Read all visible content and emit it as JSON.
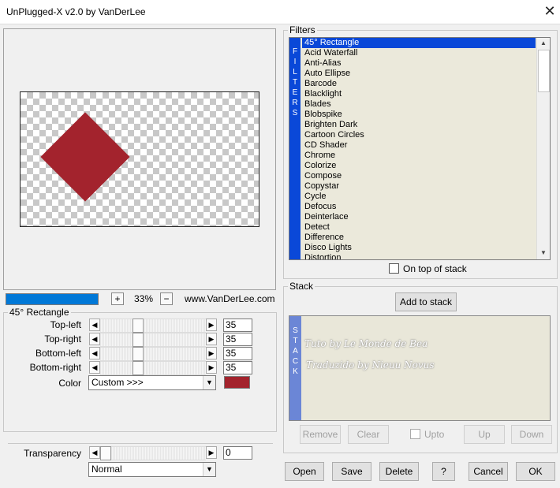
{
  "window": {
    "title": "UnPlugged-X v2.0 by VanDerLee",
    "close_glyph": "✕"
  },
  "preview": {
    "zoom_percent": "33%",
    "zoom_plus": "+",
    "zoom_minus": "−",
    "website": "www.VanDerLee.com",
    "progress_fraction": 1.0
  },
  "params": {
    "group_title": "45° Rectangle",
    "sliders": [
      {
        "label": "Top-left",
        "value": "35"
      },
      {
        "label": "Top-right",
        "value": "35"
      },
      {
        "label": "Bottom-left",
        "value": "35"
      },
      {
        "label": "Bottom-right",
        "value": "35"
      }
    ],
    "color_label": "Color",
    "color_value": "Custom >>>",
    "color_swatch": "#a3232d",
    "transparency_label": "Transparency",
    "transparency_value": "0",
    "blend_mode": "Normal"
  },
  "filters": {
    "group_title": "Filters",
    "strip_letters": [
      "F",
      "I",
      "L",
      "T",
      "E",
      "R",
      "S"
    ],
    "items": [
      "45° Rectangle",
      "Acid Waterfall",
      "Anti-Alias",
      "Auto Ellipse",
      "Barcode",
      "Blacklight",
      "Blades",
      "Blobspike",
      "Brighten Dark",
      "Cartoon Circles",
      "CD Shader",
      "Chrome",
      "Colorize",
      "Compose",
      "Copystar",
      "Cycle",
      "Defocus",
      "Deinterlace",
      "Detect",
      "Difference",
      "Disco Lights",
      "Distortion"
    ],
    "selected": "45° Rectangle",
    "on_top_label": "On top of stack",
    "on_top_checked": false
  },
  "stack": {
    "group_title": "Stack",
    "add_button": "Add to stack",
    "strip_letters": [
      "S",
      "T",
      "A",
      "C",
      "K"
    ],
    "watermark_line1": "Tuto by Le Monde de Bea",
    "watermark_line2": "Traduzido by Nieuu Novus",
    "remove": "Remove",
    "clear": "Clear",
    "upto": "Upto",
    "up": "Up",
    "down": "Down"
  },
  "footer": {
    "open": "Open",
    "save": "Save",
    "delete": "Delete",
    "help": "?",
    "cancel": "Cancel",
    "ok": "OK"
  }
}
